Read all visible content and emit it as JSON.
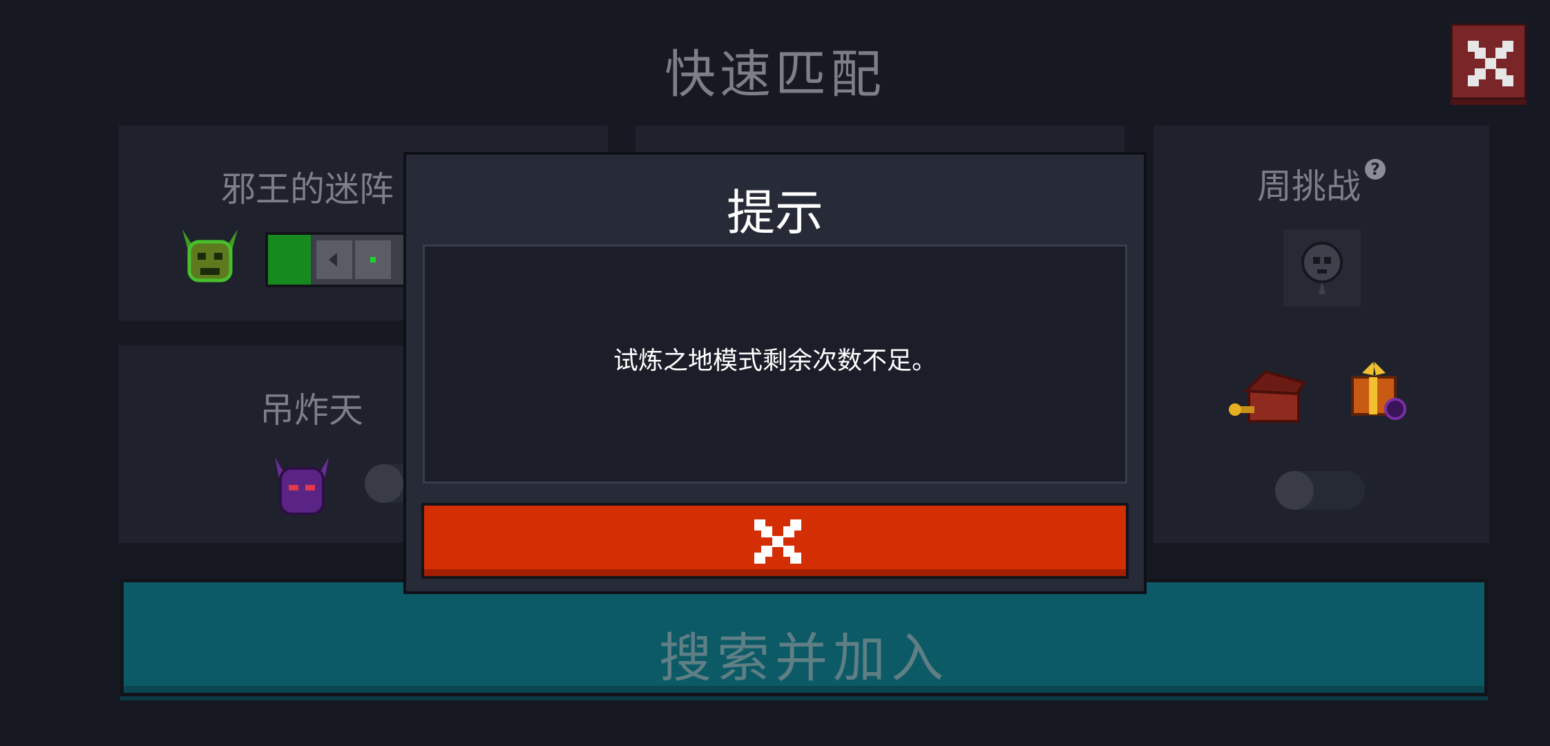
{
  "header": {
    "title": "快速匹配",
    "close_icon": "close-icon"
  },
  "cards": {
    "evil_king_maze": {
      "title": "邪王的迷阵",
      "icon": "horned-skull-icon"
    },
    "hanging_bomb": {
      "title": "吊炸天",
      "icon": "purple-demon-helmet-icon"
    },
    "weekly_challenge": {
      "title": "周挑战",
      "help_icon": "question-icon",
      "icon": "gray-skull-balloon-icon"
    }
  },
  "search_button": {
    "label": "搜索并加入"
  },
  "dialog": {
    "title": "提示",
    "message": "试炼之地模式剩余次数不足。",
    "confirm_icon": "close-icon"
  },
  "colors": {
    "background": "#161922",
    "panel": "#1f222c",
    "dialog": "#272b38",
    "confirm": "#d42e05",
    "search": "#0d5a67",
    "close_top": "#7a2629"
  }
}
